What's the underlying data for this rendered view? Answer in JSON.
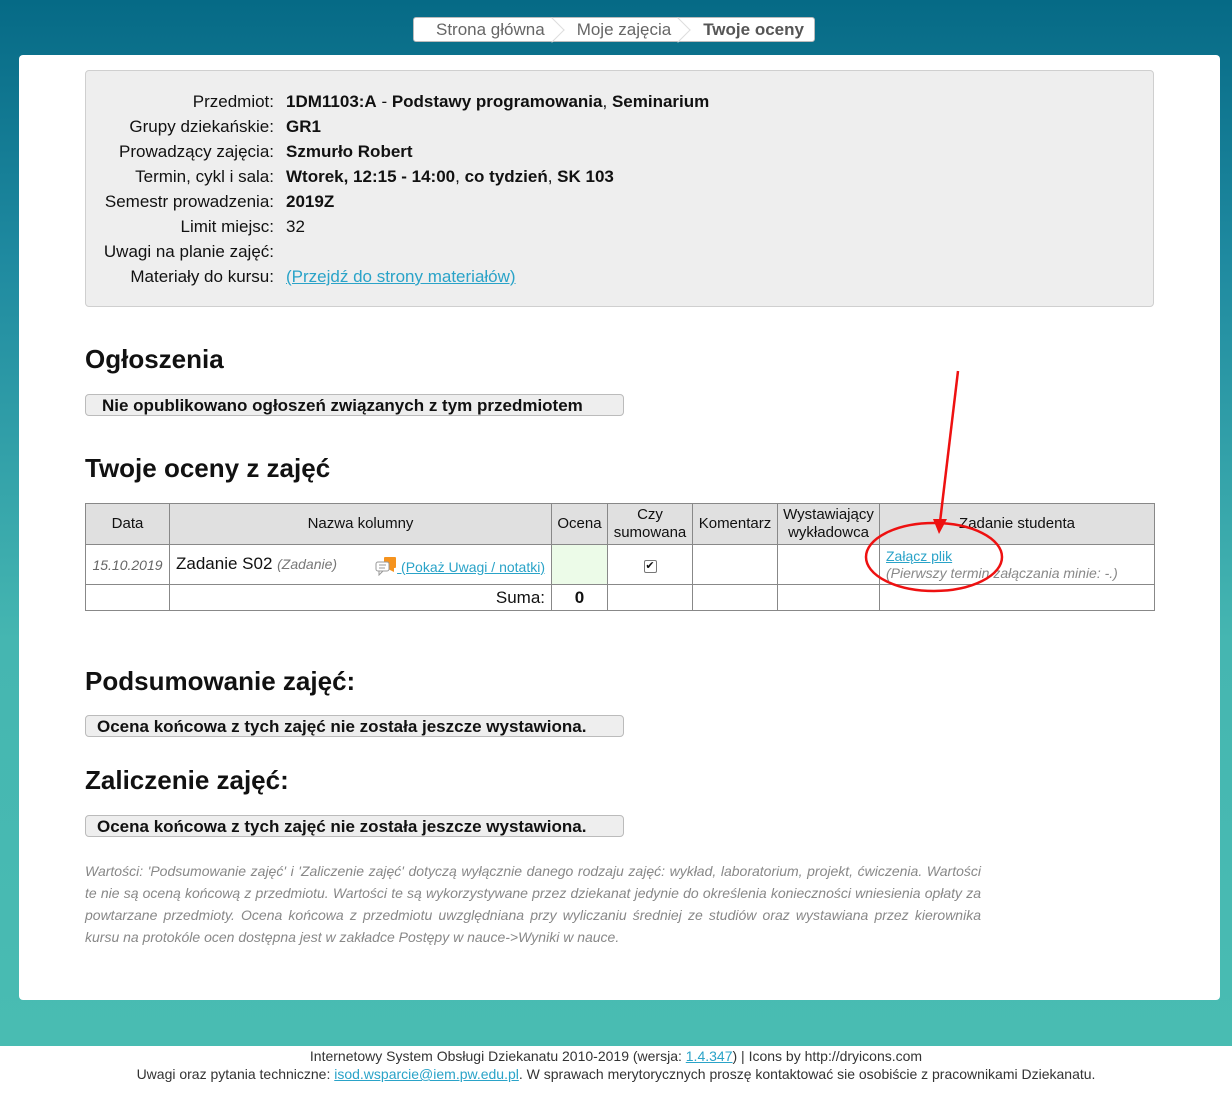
{
  "breadcrumb": {
    "home": "Strona główna",
    "classes": "Moje zajęcia",
    "current": "Twoje oceny"
  },
  "info": {
    "subject_label": "Przedmiot:",
    "subject_code": "1DM1103:A",
    "subject_dash": " - ",
    "subject_name": "Podstawy programowania",
    "subject_sep": ", ",
    "subject_form": "Seminarium",
    "groups_label": "Grupy dziekańskie:",
    "groups_value": "GR1",
    "teacher_label": "Prowadzący zajęcia:",
    "teacher_value": "Szmurło Robert",
    "schedule_label": "Termin, cykl i sala:",
    "schedule_time": "Wtorek, 12:15 - 14:00",
    "schedule_sep1": ", ",
    "schedule_cycle": "co tydzień",
    "schedule_sep2": ", ",
    "schedule_room": "SK 103",
    "semester_label": "Semestr prowadzenia:",
    "semester_value": "2019Z",
    "limit_label": "Limit miejsc:",
    "limit_value": "32",
    "notes_label": "Uwagi na planie zajęć:",
    "notes_value": "",
    "materials_label": "Materiały do kursu:",
    "materials_link": "(Przejdź do strony materiałów)"
  },
  "announcements": {
    "heading": "Ogłoszenia",
    "message": "Nie opublikowano ogłoszeń związanych z tym przedmiotem"
  },
  "grades": {
    "heading": "Twoje oceny z zajęć",
    "headers": {
      "date": "Data",
      "column": "Nazwa kolumny",
      "grade": "Ocena",
      "summed_1": "Czy",
      "summed_2": "sumowana",
      "comment": "Komentarz",
      "lecturer_1": "Wystawiający",
      "lecturer_2": "wykładowca",
      "task": "Zadanie studenta"
    },
    "rows": [
      {
        "date": "15.10.2019",
        "name": "Zadanie S02",
        "type": "(Zadanie)",
        "notes_link": " (Pokaż Uwagi / notatki)",
        "grade": "",
        "summed_mark": "✔",
        "comment": "",
        "lecturer": "",
        "task_link": "Załącz plik",
        "task_hint": "(Pierwszy termin załączania minie: -.)"
      }
    ],
    "sum_label": "Suma:",
    "sum_value": "0"
  },
  "summary": {
    "heading": "Podsumowanie zajęć:",
    "message": "Ocena końcowa z tych zajęć nie została jeszcze wystawiona."
  },
  "credit": {
    "heading": "Zaliczenie zajęć:",
    "message": "Ocena końcowa z tych zajęć nie została jeszcze wystawiona."
  },
  "footnote": "Wartości: 'Podsumowanie zajęć' i 'Zaliczenie zajęć' dotyczą wyłącznie danego rodzaju zajęć: wykład, laboratorium, projekt, ćwiczenia. Wartości te nie są oceną końcową z przedmiotu. Wartości te są wykorzystywane przez dziekanat jedynie do określenia konieczności wniesienia opłaty za powtarzane przedmioty. Ocena końcowa z przedmiotu uwzględniana przy wyliczaniu średniej ze studiów oraz wystawiana przez kierownika kursu na protokóle ocen dostępna jest w zakładce Postępy w nauce->Wyniki w nauce.",
  "footer": {
    "line1_prefix": "Internetowy System Obsługi Dziekanatu 2010-2019 (wersja: ",
    "version": "1.4.347",
    "line1_suffix": ") | Icons by http://dryicons.com",
    "line2_prefix": "Uwagi oraz pytania techniczne: ",
    "email": "isod.wsparcie@iem.pw.edu.pl",
    "line2_suffix": ". W sprawach merytorycznych proszę kontaktować sie osobiście z pracownikami Dziekanatu."
  },
  "colors": {
    "link": "#2aa3c8",
    "annotation": "#ee1111",
    "header_top": "#066a86",
    "header_bottom": "#49bcb2"
  },
  "icons": {
    "notes": "notes-speech-bubble-icon",
    "checkbox": "checkbox-checked-icon"
  }
}
